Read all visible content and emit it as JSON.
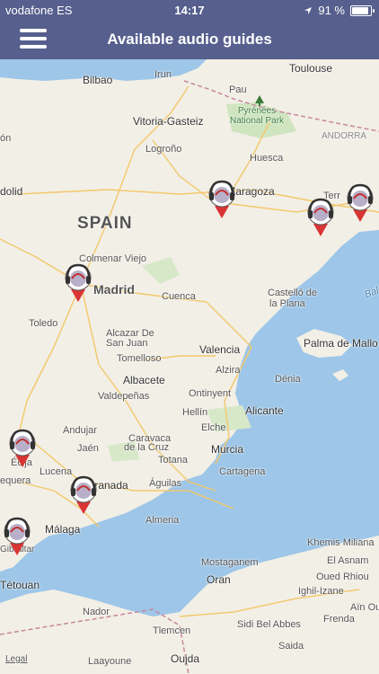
{
  "status": {
    "carrier": "vodafone ES",
    "time": "14:17",
    "battery": "91 %",
    "battery_level": 0.91
  },
  "header": {
    "title": "Available audio guides"
  },
  "map": {
    "country_label": "SPAIN",
    "legal": "Legal",
    "park_line1": "Pyrénées",
    "park_line2": "National Park",
    "places": {
      "irun": "Irun",
      "toulouse": "Toulouse",
      "bilbao": "Bilbao",
      "pau": "Pau",
      "vitoria": "Vitoria-Gasteiz",
      "logrono": "Logroño",
      "andorra": "ANDORRA",
      "huesca": "Huesca",
      "lon": "ón",
      "zaragoza": "Zaragoza",
      "dolid": "dolid",
      "terr": "Terr",
      "colmenar": "Colmenar Viejo",
      "madrid": "Madrid",
      "cuenca": "Cuenca",
      "castello1": "Castelló de",
      "castello2": "la Plana",
      "toledo": "Toledo",
      "alcazar1": "Alcazar De",
      "alcazar2": "San Juan",
      "valencia": "Valencia",
      "palma": "Palma de Mallo",
      "tomelloso": "Tomelloso",
      "alzira": "Alzira",
      "albacete": "Albacete",
      "valdepenas": "Valdepeñas",
      "ontinyent": "Ontinyent",
      "denia": "Dénia",
      "hellin": "Hellín",
      "alicante": "Alicante",
      "andujar": "Andujar",
      "caravaca": "Caravaca",
      "delacruz": "de la Cruz",
      "elche": "Elche",
      "jaen": "Jaén",
      "murcia": "Murcia",
      "totana": "Totana",
      "lucena": "Lucena",
      "cartagena": "Cartagena",
      "aguilas": "Águilas",
      "ecija": "Écija",
      "equera": "equera",
      "granada": "Granada",
      "almeria": "Almeria",
      "malaga": "Málaga",
      "gibraltar": "Gibraltar",
      "khemis": "Khemis Miliana",
      "mostaganem": "Mostaganem",
      "elasnam": "El Asnam",
      "tetouan": "Tétouan",
      "oran": "Oran",
      "ouedrhiou": "Oued Rhiou",
      "ighil": "Ighil-Izane",
      "ainou": "Aïn Ou",
      "nador": "Nador",
      "frenda": "Frenda",
      "tlemcen": "Tlemcen",
      "sidibel": "Sidi Bel Abbes",
      "saida": "Saida",
      "laayoune": "Laayoune",
      "oujda": "Oujda",
      "bal": "Bal"
    }
  },
  "colors": {
    "header": "#565f8d",
    "sea": "#9dc6e8",
    "land": "#f2efe6",
    "marker": "#d93535"
  }
}
